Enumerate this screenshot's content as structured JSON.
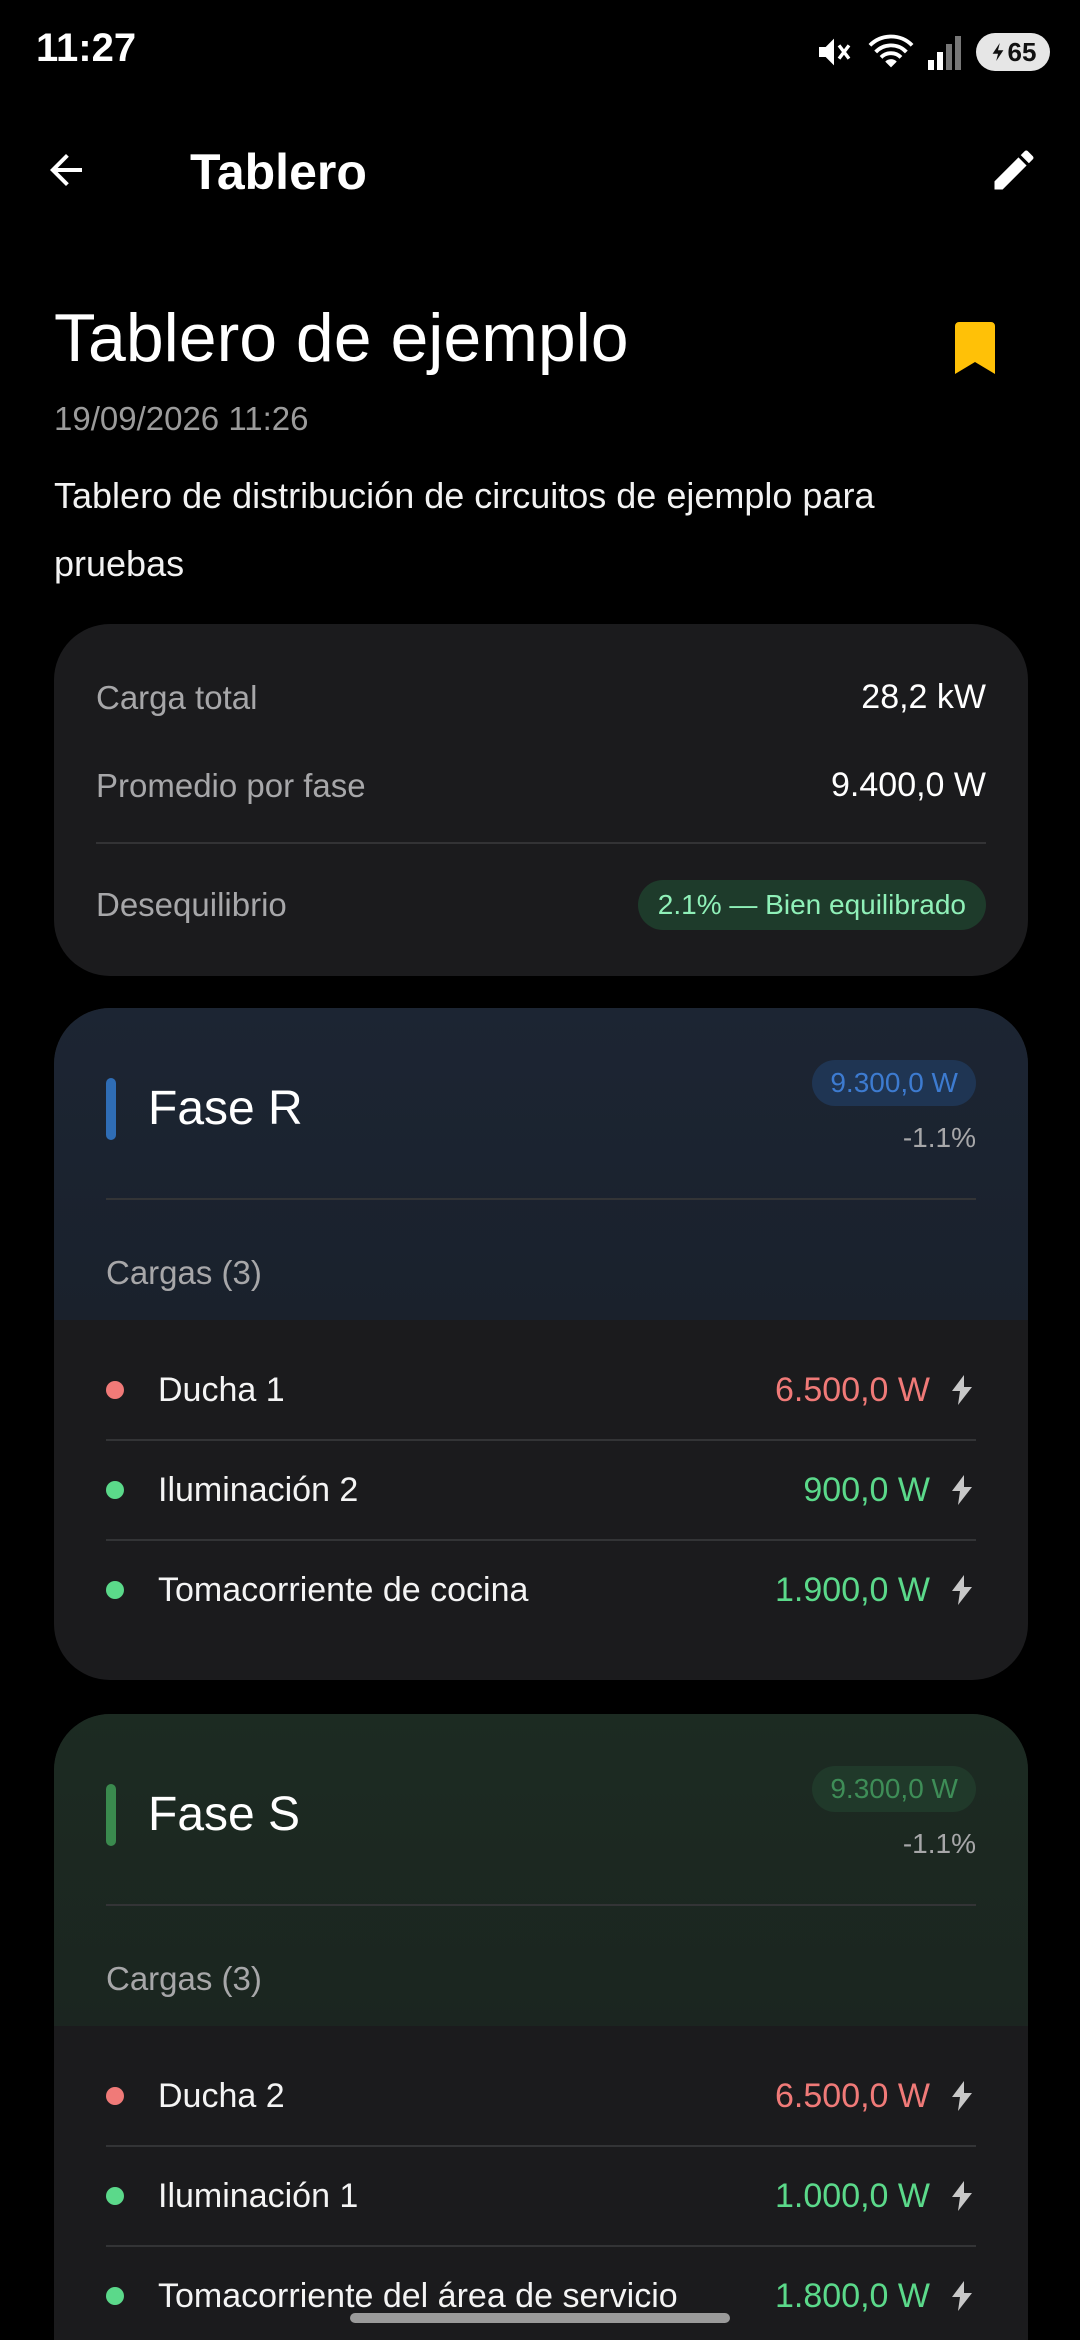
{
  "status_bar": {
    "time": "11:27",
    "battery": "65",
    "icons": [
      "mute-icon",
      "wifi-icon",
      "signal-icon",
      "battery-icon"
    ]
  },
  "app_bar": {
    "title": "Tablero",
    "back_icon": "arrow-back-icon",
    "edit_icon": "pencil-icon"
  },
  "board": {
    "title": "Tablero de ejemplo",
    "timestamp": "19/09/2026 11:26",
    "description": "Tablero de distribución de circuitos de ejemplo para pruebas",
    "bookmark_color": "#FFC107"
  },
  "summary": {
    "total_label": "Carga total",
    "total_value": "28,2 kW",
    "avg_label": "Promedio por fase",
    "avg_value": "9.400,0 W",
    "imbalance_label": "Desequilibrio",
    "imbalance_value": "2.1% — Bien equilibrado"
  },
  "phases": [
    {
      "name": "Fase R",
      "power": "9.300,0 W",
      "diff": "-1.1%",
      "accent": "#2F6DB5",
      "loads_label": "Cargas (3)",
      "loads": [
        {
          "name": "Ducha 1",
          "power": "6.500,0 W",
          "status": "high",
          "color": "#F07A78"
        },
        {
          "name": "Iluminación 2",
          "power": "900,0 W",
          "status": "ok",
          "color": "#5BD98A"
        },
        {
          "name": "Tomacorriente de cocina",
          "power": "1.900,0 W",
          "status": "ok",
          "color": "#5BD98A"
        }
      ]
    },
    {
      "name": "Fase S",
      "power": "9.300,0 W",
      "diff": "-1.1%",
      "accent": "#3A8A4E",
      "loads_label": "Cargas (3)",
      "loads": [
        {
          "name": "Ducha 2",
          "power": "6.500,0 W",
          "status": "high",
          "color": "#F07A78"
        },
        {
          "name": "Iluminación 1",
          "power": "1.000,0 W",
          "status": "ok",
          "color": "#5BD98A"
        },
        {
          "name": "Tomacorriente del área de servicio",
          "power": "1.800,0 W",
          "status": "ok",
          "color": "#5BD98A"
        }
      ]
    }
  ]
}
